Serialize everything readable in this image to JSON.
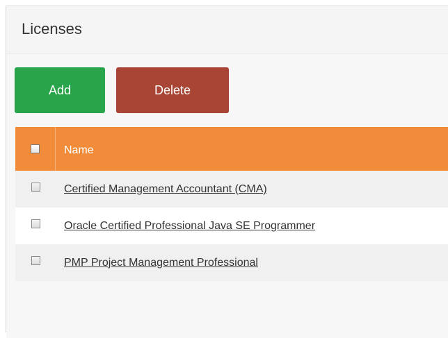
{
  "panel": {
    "title": "Licenses"
  },
  "toolbar": {
    "add_label": "Add",
    "delete_label": "Delete"
  },
  "colors": {
    "add_button": "#2aa44a",
    "delete_button": "#a94534",
    "table_header": "#f08c3a"
  },
  "table": {
    "columns": [
      "Name"
    ],
    "rows": [
      {
        "name": "Certified Management Accountant (CMA)"
      },
      {
        "name": "Oracle Certified Professional Java SE Programmer"
      },
      {
        "name": "PMP Project Management Professional"
      }
    ]
  }
}
